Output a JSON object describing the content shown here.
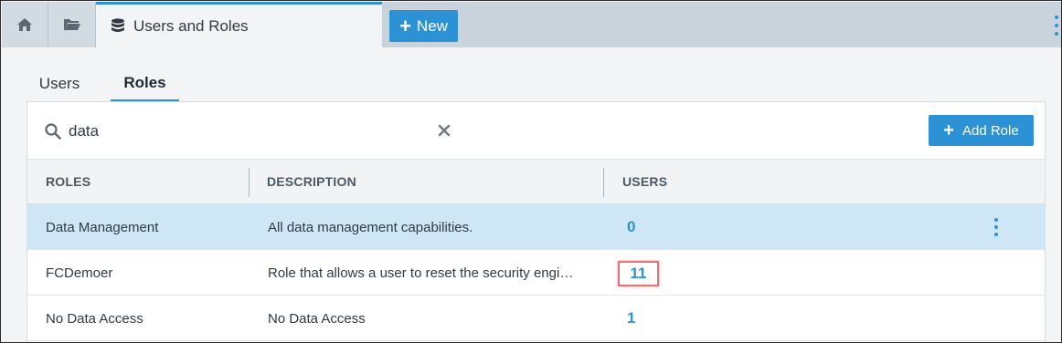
{
  "tabs": {
    "home_icon": "home-icon",
    "folder_icon": "folder-icon",
    "active_tab": {
      "icon": "database-icon",
      "label": "Users and Roles"
    },
    "new_button": {
      "label": "New"
    }
  },
  "subtabs": [
    {
      "label": "Users",
      "active": false
    },
    {
      "label": "Roles",
      "active": true
    }
  ],
  "search": {
    "value": "data"
  },
  "add_role": {
    "label": "Add Role"
  },
  "table": {
    "columns": [
      "ROLES",
      "DESCRIPTION",
      "USERS"
    ],
    "rows": [
      {
        "role": "Data Management",
        "description": "All data management capabilities.",
        "users": "0",
        "selected": true
      },
      {
        "role": "FCDemoer",
        "description": "Role that allows a user to reset the security engi…",
        "users": "11",
        "highlighted": true
      },
      {
        "role": "No Data Access",
        "description": "No Data Access",
        "users": "1"
      }
    ]
  },
  "colors": {
    "accent": "#2d91d6",
    "selected_row": "#cfe6f7",
    "highlight_box": "#e57373"
  }
}
